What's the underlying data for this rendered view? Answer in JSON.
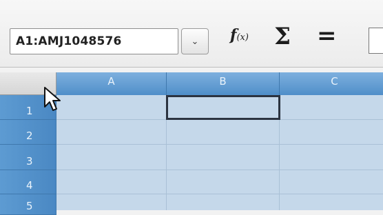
{
  "formula_bar": {
    "name_box_value": "A1:AMJ1048576",
    "name_box_dropdown_icon": "chevron-down-icon",
    "function_wizard_icon": "fx-icon",
    "function_wizard_label": "f",
    "function_wizard_sub": "(x)",
    "sum_label": "Σ",
    "formula_label": "=",
    "formula_input_value": ""
  },
  "grid": {
    "columns": [
      "A",
      "B",
      "C"
    ],
    "rows": [
      "1",
      "2",
      "3",
      "4",
      "5"
    ],
    "selected_cell": "B1",
    "header_color": "#5a96ce",
    "selection_fill": "#c5d8ea"
  },
  "cursor_icon": "mouse-pointer-icon"
}
